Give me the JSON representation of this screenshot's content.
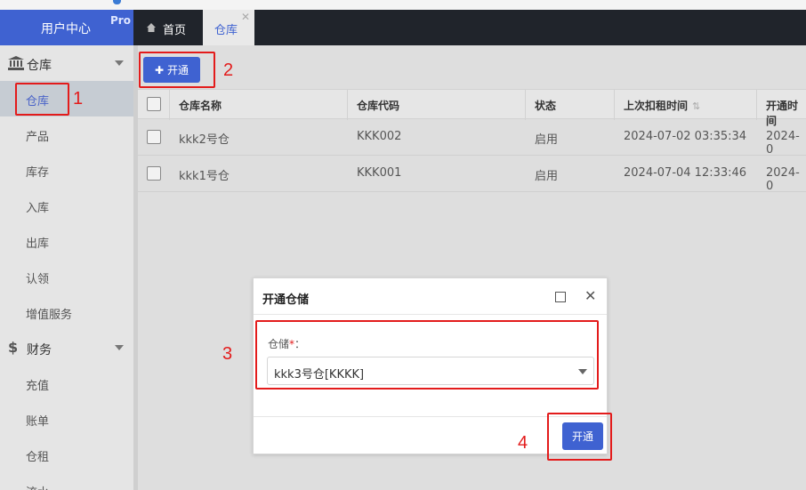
{
  "sidebar": {
    "brand": "用户中心",
    "brand_badge": "Pro",
    "groups": [
      {
        "label": "仓库",
        "icon": "bank-icon"
      },
      {
        "label": "财务",
        "icon": "dollar-icon"
      }
    ],
    "warehouse_items": [
      "仓库",
      "产品",
      "库存",
      "入库",
      "出库",
      "认领",
      "增值服务"
    ],
    "finance_items": [
      "充值",
      "账单",
      "仓租",
      "流水"
    ]
  },
  "tabs": {
    "home": "首页",
    "current": "仓库"
  },
  "toolbar": {
    "open_label": "开通"
  },
  "table": {
    "columns": [
      "仓库名称",
      "仓库代码",
      "状态",
      "上次扣租时间",
      "开通时间"
    ],
    "rows": [
      {
        "name": "kkk2号仓",
        "code": "KKK002",
        "status": "启用",
        "last_charge": "2024-07-02 03:35:34",
        "open_time": "2024-0"
      },
      {
        "name": "kkk1号仓",
        "code": "KKK001",
        "status": "启用",
        "last_charge": "2024-07-04 12:33:46",
        "open_time": "2024-0"
      }
    ]
  },
  "dialog": {
    "title": "开通仓储",
    "field_label": "仓储",
    "required_mark": "*",
    "colon": "：",
    "selected": "kkk3号仓[KKKK]",
    "submit": "开通"
  },
  "annotations": [
    "1",
    "2",
    "3",
    "4"
  ],
  "colors": {
    "primary": "#3f62d1",
    "annotation_red": "#e31b1b",
    "tabbar": "#20242b"
  }
}
